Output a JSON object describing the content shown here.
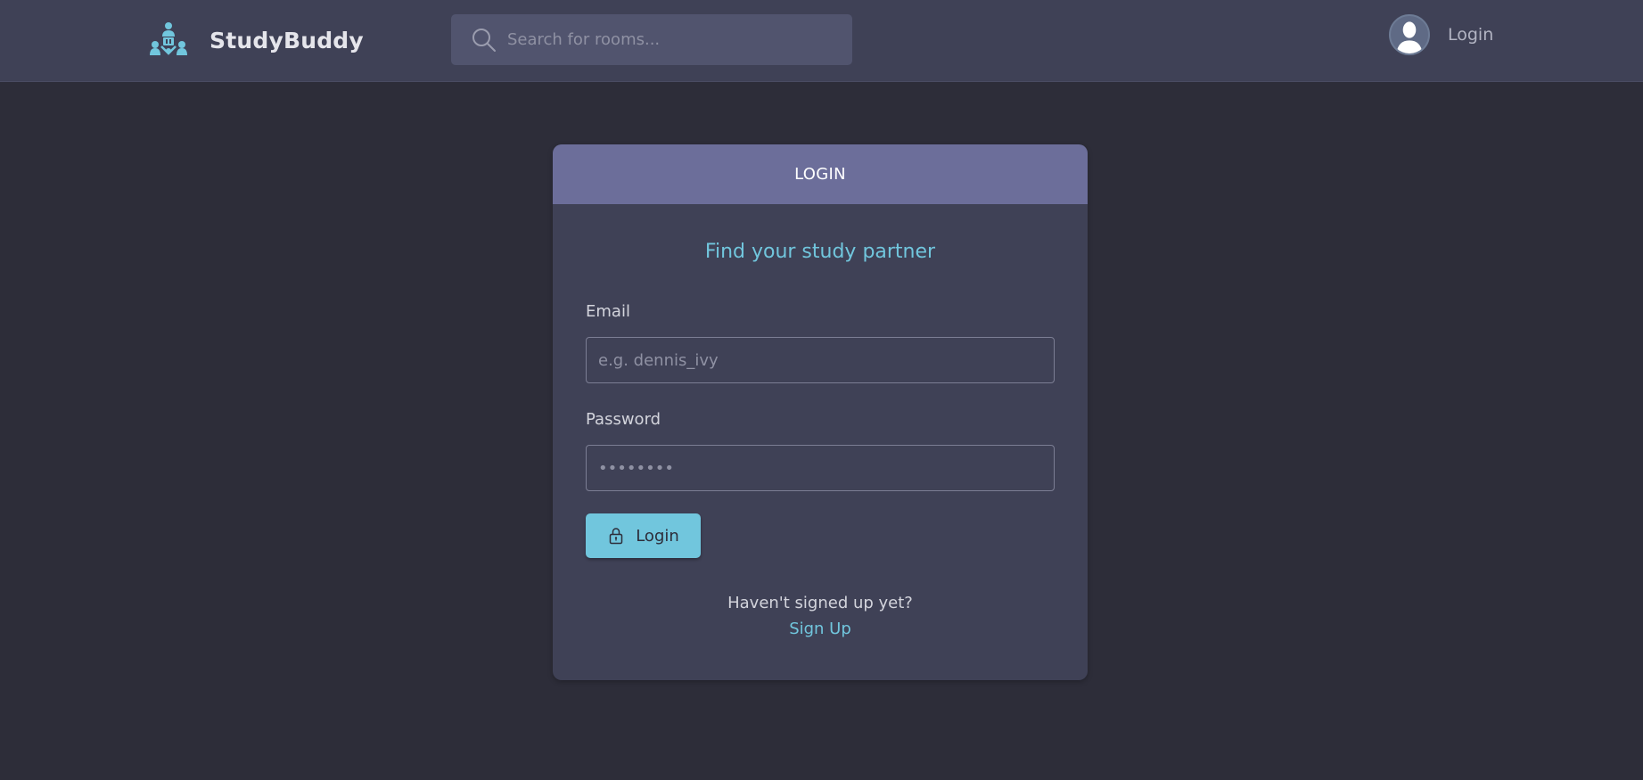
{
  "header": {
    "brand": "StudyBuddy",
    "search": {
      "placeholder": "Search for rooms..."
    },
    "account": {
      "label": "Login"
    }
  },
  "login": {
    "card_title": "LOGIN",
    "tagline": "Find your study partner",
    "email": {
      "label": "Email",
      "placeholder": "e.g. dennis_ivy",
      "value": ""
    },
    "password": {
      "label": "Password",
      "placeholder": "••••••••",
      "value": ""
    },
    "submit_label": "Login",
    "signup_prompt": "Haven't signed up yet?",
    "signup_link": "Sign Up"
  },
  "icons": {
    "logo": "studybuddy-logo-icon",
    "search": "search-icon",
    "avatar": "avatar-icon",
    "lock": "lock-icon"
  },
  "colors": {
    "accent": "#71c6dd",
    "card_header": "#6c6e9a",
    "surface": "#3f4156",
    "background": "#2d2d39"
  }
}
